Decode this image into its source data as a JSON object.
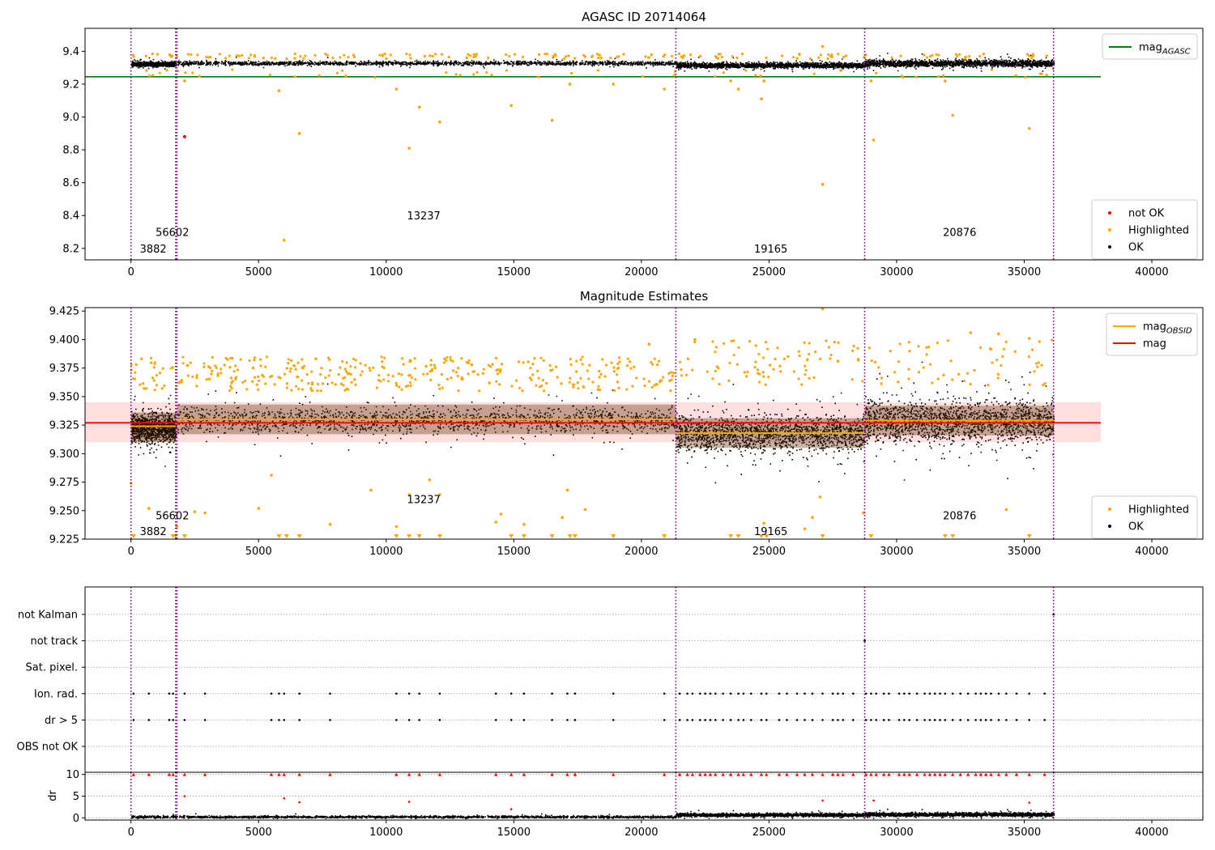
{
  "colors": {
    "ok": "#000000",
    "highlighted": "#ffa500",
    "not_ok": "#ff0000",
    "mag_agasc_line": "#008000",
    "mag_obsid_line": "#ffa500",
    "mag_line": "#ff0000",
    "obs_boundary": "#800080",
    "band_fill": "#ffb0b0"
  },
  "chart_data": [
    {
      "type": "scatter",
      "title": "AGASC ID 20714064",
      "xlabel": "",
      "ylabel": "",
      "xlim": [
        -1800,
        42000
      ],
      "ylim": [
        8.13,
        9.54
      ],
      "xticks": [
        "0",
        "5000",
        "10000",
        "15000",
        "20000",
        "25000",
        "30000",
        "35000",
        "40000"
      ],
      "yticks": [
        "8.2",
        "8.4",
        "8.6",
        "8.8",
        "9.0",
        "9.2",
        "9.4"
      ],
      "observation_boundaries": [
        0,
        1750,
        1800,
        21350,
        28750,
        36150
      ],
      "observation_labels": [
        {
          "text": "3882",
          "x": 300,
          "y": 8.2
        },
        {
          "text": "56602",
          "x": 1050,
          "y": 8.3
        },
        {
          "text": "13237",
          "x": 10900,
          "y": 8.4
        },
        {
          "text": "19165",
          "x": 24500,
          "y": 8.2
        },
        {
          "text": "20876",
          "x": 31900,
          "y": 8.3
        }
      ],
      "series": [
        {
          "name": "mag_AGASC",
          "kind": "line",
          "y": 9.245,
          "x": [
            -1800,
            38000
          ]
        },
        {
          "name": "not OK",
          "kind": "points",
          "points": [
            [
              2100,
              8.88
            ]
          ]
        },
        {
          "name": "Highlighted",
          "kind": "points",
          "points": [
            [
              6000,
              8.25
            ],
            [
              6600,
              8.9
            ],
            [
              10900,
              8.81
            ],
            [
              11300,
              9.06
            ],
            [
              12100,
              8.97
            ],
            [
              14900,
              9.07
            ],
            [
              16500,
              8.98
            ],
            [
              17200,
              9.2
            ],
            [
              18900,
              9.2
            ],
            [
              20900,
              9.17
            ],
            [
              23500,
              9.22
            ],
            [
              23800,
              9.17
            ],
            [
              24700,
              9.11
            ],
            [
              24800,
              9.22
            ],
            [
              27100,
              8.59
            ],
            [
              27100,
              9.43
            ],
            [
              29000,
              9.22
            ],
            [
              29100,
              8.86
            ],
            [
              31900,
              9.22
            ],
            [
              32200,
              9.01
            ],
            [
              35200,
              8.93
            ],
            [
              10400,
              9.17
            ],
            [
              2100,
              9.22
            ],
            [
              5800,
              9.16
            ]
          ]
        },
        {
          "name": "OK",
          "kind": "band_noise",
          "segments": [
            {
              "x": [
                0,
                1750
              ],
              "center": 9.325,
              "spread": 0.012
            },
            {
              "x": [
                1800,
                21350
              ],
              "center": 9.331,
              "spread": 0.012
            },
            {
              "x": [
                21350,
                28750
              ],
              "center": 9.318,
              "spread": 0.016
            },
            {
              "x": [
                28750,
                36150
              ],
              "center": 9.33,
              "spread": 0.02
            }
          ]
        }
      ],
      "legends": [
        {
          "position": "upper right",
          "entries": [
            {
              "label": "mag",
              "subscript": "AGASC",
              "kind": "line",
              "color_key": "mag_agasc_line"
            }
          ]
        },
        {
          "position": "lower right",
          "entries": [
            {
              "label": "not OK",
              "kind": "dot",
              "color_key": "not_ok"
            },
            {
              "label": "Highlighted",
              "kind": "dot",
              "color_key": "highlighted"
            },
            {
              "label": "OK",
              "kind": "dot",
              "color_key": "ok"
            }
          ]
        }
      ]
    },
    {
      "type": "scatter",
      "title": "Magnitude Estimates",
      "xlabel": "",
      "ylabel": "",
      "xlim": [
        -1800,
        42000
      ],
      "ylim": [
        9.225,
        9.428
      ],
      "xticks": [
        "0",
        "5000",
        "10000",
        "15000",
        "20000",
        "25000",
        "30000",
        "35000",
        "40000"
      ],
      "yticks": [
        "9.225",
        "9.250",
        "9.275",
        "9.300",
        "9.325",
        "9.350",
        "9.375",
        "9.400",
        "9.425"
      ],
      "observation_boundaries": [
        0,
        1750,
        1800,
        21350,
        28750,
        36150
      ],
      "observation_labels": [
        {
          "text": "3882",
          "x": 300,
          "y": 9.232
        },
        {
          "text": "56602",
          "x": 1050,
          "y": 9.246
        },
        {
          "text": "13237",
          "x": 10900,
          "y": 9.26
        },
        {
          "text": "19165",
          "x": 24500,
          "y": 9.232
        },
        {
          "text": "20876",
          "x": 31900,
          "y": 9.246
        }
      ],
      "mag_band": {
        "y0": 9.31,
        "y1": 9.345,
        "x": [
          -1800,
          38000
        ]
      },
      "series": [
        {
          "name": "mag_OBSID",
          "kind": "steps",
          "segments": [
            {
              "x": [
                0,
                1750
              ],
              "y": 9.324
            },
            {
              "x": [
                1800,
                21350
              ],
              "y": 9.33
            },
            {
              "x": [
                21350,
                28750
              ],
              "y": 9.318
            },
            {
              "x": [
                28750,
                36150
              ],
              "y": 9.329
            }
          ]
        },
        {
          "name": "mag",
          "kind": "line",
          "y": 9.327,
          "x": [
            -1800,
            38000
          ]
        },
        {
          "name": "Highlighted",
          "kind": "points",
          "points": [
            [
              0,
              9.274
            ],
            [
              700,
              9.252
            ],
            [
              1800,
              9.236
            ],
            [
              2500,
              9.249
            ],
            [
              2900,
              9.248
            ],
            [
              5000,
              9.252
            ],
            [
              5500,
              9.281
            ],
            [
              7800,
              9.238
            ],
            [
              9400,
              9.268
            ],
            [
              10400,
              9.236
            ],
            [
              10900,
              9.264
            ],
            [
              11700,
              9.277
            ],
            [
              12100,
              9.264
            ],
            [
              14300,
              9.24
            ],
            [
              14500,
              9.247
            ],
            [
              15400,
              9.238
            ],
            [
              16900,
              9.244
            ],
            [
              17100,
              9.268
            ],
            [
              17800,
              9.251
            ],
            [
              24800,
              9.239
            ],
            [
              26400,
              9.234
            ],
            [
              26700,
              9.244
            ],
            [
              27000,
              9.262
            ],
            [
              27100,
              9.427
            ],
            [
              27700,
              9.381
            ],
            [
              28700,
              9.248
            ],
            [
              34300,
              9.251
            ],
            [
              22100,
              9.4
            ],
            [
              20300,
              9.396
            ],
            [
              32900,
              9.406
            ],
            [
              34000,
              9.405
            ],
            [
              35200,
              9.401
            ]
          ]
        },
        {
          "name": "Highlighted_offscale",
          "kind": "markers",
          "x": [
            100,
            1650,
            1750,
            2100,
            5800,
            6100,
            6600,
            10400,
            10900,
            11300,
            12100,
            14900,
            15400,
            16500,
            17200,
            17400,
            18900,
            20900,
            23500,
            23800,
            24700,
            24900,
            27100,
            29000,
            31900,
            32200,
            35200
          ]
        },
        {
          "name": "OK",
          "kind": "band_noise",
          "segments": [
            {
              "x": [
                0,
                1750
              ],
              "center": 9.323,
              "spread": 0.012
            },
            {
              "x": [
                1800,
                21350
              ],
              "center": 9.33,
              "spread": 0.011
            },
            {
              "x": [
                21350,
                28750
              ],
              "center": 9.318,
              "spread": 0.015
            },
            {
              "x": [
                28750,
                36150
              ],
              "center": 9.329,
              "spread": 0.018
            }
          ]
        }
      ],
      "legends": [
        {
          "position": "upper right",
          "entries": [
            {
              "label": "mag",
              "subscript": "OBSID",
              "kind": "line",
              "color_key": "mag_obsid_line"
            },
            {
              "label": "mag",
              "kind": "line",
              "color_key": "mag_line"
            }
          ]
        },
        {
          "position": "lower right",
          "entries": [
            {
              "label": "Highlighted",
              "kind": "dot",
              "color_key": "highlighted"
            },
            {
              "label": "OK",
              "kind": "dot",
              "color_key": "ok"
            }
          ]
        }
      ]
    },
    {
      "type": "scatter",
      "title": "",
      "xlabel": "",
      "ylabel": "",
      "xlim": [
        -1800,
        42000
      ],
      "xticks": [],
      "flag_categories": [
        "not Kalman",
        "not track",
        "Sat. pixel.",
        "Ion. rad.",
        "dr > 5",
        "OBS not OK"
      ],
      "observation_boundaries": [
        0,
        1750,
        1800,
        21350,
        28750,
        36150
      ],
      "flag_events": {
        "Ion. rad.": [
          100,
          700,
          1500,
          1650,
          2100,
          2900,
          5500,
          5800,
          6000,
          6600,
          7800,
          10400,
          10900,
          11300,
          12100,
          14300,
          14900,
          15400,
          16500,
          17100,
          17400,
          18900,
          20900,
          21500,
          21800,
          22000,
          22300,
          22500,
          22700,
          22900,
          23200,
          23500,
          23800,
          24000,
          24300,
          24700,
          24900,
          25400,
          25700,
          26100,
          26400,
          26700,
          27100,
          27500,
          27700,
          27900,
          28300,
          28800,
          29000,
          29200,
          29500,
          29700,
          30100,
          30300,
          30500,
          30800,
          31100,
          31300,
          31500,
          31700,
          31900,
          32200,
          32500,
          32800,
          33100,
          33300,
          33500,
          33700,
          34000,
          34300,
          34700,
          35200,
          35800
        ],
        "dr > 5": [
          100,
          700,
          1500,
          1650,
          2100,
          2900,
          5500,
          5800,
          6000,
          6600,
          7800,
          10400,
          10900,
          11300,
          12100,
          14300,
          14900,
          15400,
          16500,
          17100,
          17400,
          18900,
          20900,
          21500,
          21800,
          22000,
          22300,
          22500,
          22700,
          22900,
          23200,
          23500,
          23800,
          24000,
          24300,
          24700,
          24900,
          25400,
          25700,
          26100,
          26400,
          26700,
          27100,
          27500,
          27700,
          27900,
          28300,
          28800,
          29000,
          29200,
          29500,
          29700,
          30100,
          30300,
          30500,
          30800,
          31100,
          31300,
          31500,
          31700,
          31900,
          32200,
          32500,
          32800,
          33100,
          33300,
          33500,
          33700,
          34000,
          34300,
          34700,
          35200,
          35800
        ],
        "not track": [
          28750
        ],
        "not Kalman": [
          36150
        ]
      }
    },
    {
      "type": "scatter",
      "title": "",
      "xlabel": "",
      "ylabel": "dr",
      "xlim": [
        -1800,
        42000
      ],
      "ylim": [
        -0.5,
        10.5
      ],
      "xticks": [
        "0",
        "5000",
        "10000",
        "15000",
        "20000",
        "25000",
        "30000",
        "35000",
        "40000"
      ],
      "yticks": [
        "0",
        "5",
        "10"
      ],
      "observation_boundaries": [
        0,
        1750,
        1800,
        21350,
        28750,
        36150
      ],
      "series": [
        {
          "name": "dr_noise",
          "kind": "band_noise",
          "segments": [
            {
              "x": [
                0,
                21350
              ],
              "center": 0.35,
              "spread": 0.25
            },
            {
              "x": [
                21350,
                28750
              ],
              "center": 0.8,
              "spread": 0.35
            },
            {
              "x": [
                28750,
                36150
              ],
              "center": 0.9,
              "spread": 0.4
            }
          ]
        },
        {
          "name": "dr_outliers",
          "kind": "points",
          "points": [
            [
              2100,
              5.0
            ],
            [
              6000,
              4.5
            ],
            [
              6600,
              3.6
            ],
            [
              10900,
              3.7
            ],
            [
              14900,
              2.0
            ],
            [
              27100,
              4.0
            ],
            [
              29100,
              4.0
            ],
            [
              35200,
              3.5
            ]
          ]
        },
        {
          "name": "dr_clipped",
          "kind": "markers",
          "y": 10
        }
      ]
    }
  ]
}
